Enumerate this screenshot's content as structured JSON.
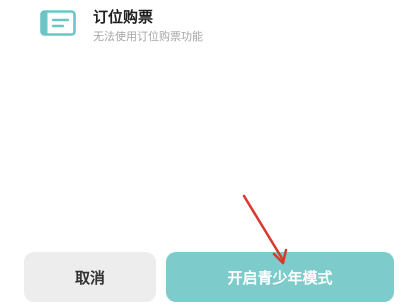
{
  "feature": {
    "icon": "ticket-icon",
    "title": "订位购票",
    "subtitle": "无法使用订位购票功能"
  },
  "buttons": {
    "cancel_label": "取消",
    "confirm_label": "开启青少年模式"
  },
  "colors": {
    "accent": "#7ecbcb",
    "icon": "#6cc5c5",
    "cancel_bg": "#ededed",
    "annotation_arrow": "#d9382c"
  }
}
